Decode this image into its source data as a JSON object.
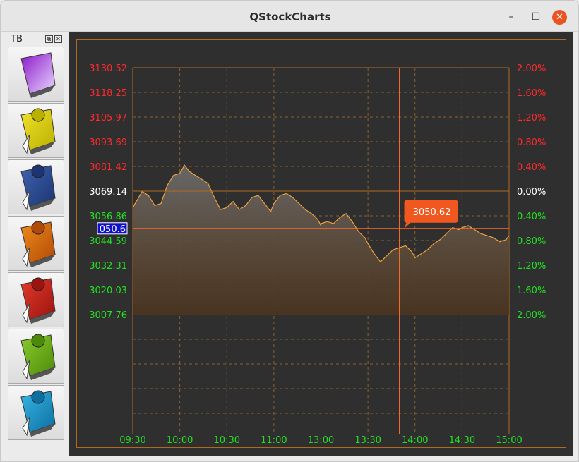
{
  "window": {
    "title": "QStockCharts"
  },
  "window_controls": {
    "minimize": "–",
    "maximize": "☐",
    "close": "✕"
  },
  "toolbar": {
    "title": "TB",
    "float_icon": "⧉",
    "close_icon": "✕",
    "buttons": [
      {
        "name": "app-logo-icon",
        "colors": [
          "#8a16c9",
          "#e9d8ff"
        ]
      },
      {
        "name": "yoono-icon",
        "colors": [
          "#f2e22a",
          "#b9b000"
        ]
      },
      {
        "name": "facebook-icon",
        "colors": [
          "#3f62b0",
          "#1c3572"
        ]
      },
      {
        "name": "firefox-icon",
        "colors": [
          "#f08a1a",
          "#b04a08"
        ]
      },
      {
        "name": "rss-icon",
        "colors": [
          "#e33a2a",
          "#9a1410"
        ]
      },
      {
        "name": "stumbleupon-icon",
        "colors": [
          "#8acb2a",
          "#4c8a0c"
        ]
      },
      {
        "name": "twitter-icon",
        "colors": [
          "#36b4e6",
          "#0c6fa0"
        ]
      }
    ]
  },
  "colors": {
    "up": "#ff2a2a",
    "down": "#22e022",
    "neutral": "#ffffff",
    "border": "#b06a20",
    "grid": "#8a6030",
    "price_line": "#ff6a2a",
    "tooltip": "#f0581f"
  },
  "chart_data": {
    "type": "area",
    "y_left_ticks": [
      "3130.52",
      "3118.25",
      "3105.97",
      "3093.69",
      "3081.42",
      "3069.14",
      "3056.86",
      "3044.59",
      "3032.31",
      "3020.03",
      "3007.76"
    ],
    "y_right_ticks": [
      "2.00%",
      "1.60%",
      "1.20%",
      "0.80%",
      "0.40%",
      "0.00%",
      "0.40%",
      "0.80%",
      "1.20%",
      "1.60%",
      "2.00%"
    ],
    "x_ticks": [
      "09:30",
      "10:00",
      "10:30",
      "11:00",
      "13:00",
      "13:30",
      "14:00",
      "14:30",
      "15:00"
    ],
    "ylim": [
      3007.76,
      3130.52
    ],
    "prev_close": 3069.14,
    "crosshair": {
      "time": "13:50",
      "value": "3050.62"
    },
    "current_price_label": "050.6",
    "series": [
      {
        "time": [
          "09:30",
          "09:33",
          "09:36",
          "09:40",
          "09:44",
          "09:48",
          "09:52",
          "09:56",
          "10:00",
          "10:03",
          "10:06",
          "10:10",
          "10:14",
          "10:18",
          "10:22",
          "10:26",
          "10:30",
          "10:34",
          "10:38",
          "10:42",
          "10:46",
          "10:50",
          "10:54",
          "10:58",
          "11:00",
          "11:04",
          "11:08",
          "11:12",
          "11:16",
          "11:20",
          "11:24",
          "11:28",
          "11:30",
          "13:00",
          "13:04",
          "13:08",
          "13:12",
          "13:16",
          "13:20",
          "13:24",
          "13:28",
          "13:30",
          "13:34",
          "13:38",
          "13:42",
          "13:46",
          "13:50",
          "13:54",
          "13:58",
          "14:00",
          "14:04",
          "14:08",
          "14:12",
          "14:16",
          "14:20",
          "14:24",
          "14:28",
          "14:30",
          "14:34",
          "14:38",
          "14:42",
          "14:46",
          "14:50",
          "14:54",
          "14:58",
          "15:00"
        ],
        "values": [
          3061,
          3065,
          3069,
          3067,
          3062,
          3063,
          3072,
          3077,
          3078,
          3082,
          3079,
          3077,
          3075,
          3073,
          3066,
          3060,
          3061,
          3064,
          3060,
          3062,
          3066,
          3067,
          3063,
          3059,
          3063,
          3067,
          3068,
          3066,
          3063,
          3060,
          3058,
          3055,
          3052,
          3053,
          3054,
          3053,
          3056,
          3058,
          3054,
          3049,
          3046,
          3043,
          3038,
          3034,
          3037,
          3040,
          3041,
          3042,
          3039,
          3036,
          3038,
          3040,
          3043,
          3045,
          3048,
          3051,
          3050,
          3051,
          3052,
          3050,
          3048,
          3047,
          3046,
          3044,
          3045,
          3047
        ]
      }
    ]
  }
}
